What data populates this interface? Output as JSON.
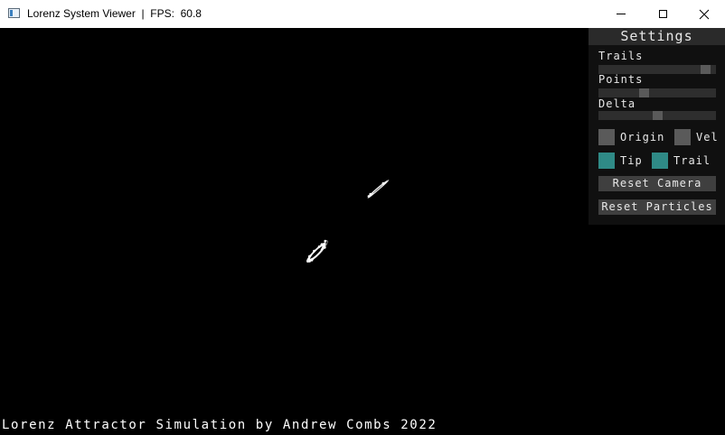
{
  "window": {
    "title": "Lorenz System Viewer  |  FPS:  60.8",
    "minimize_icon": "minimize-icon",
    "maximize_icon": "maximize-icon",
    "close_icon": "close-icon"
  },
  "settings": {
    "title": "Settings",
    "sliders": [
      {
        "label": "Trails",
        "value": 0.95
      },
      {
        "label": "Points",
        "value": 0.38
      },
      {
        "label": "Delta",
        "value": 0.5
      }
    ],
    "checkboxes": [
      {
        "label": "Origin",
        "checked": false
      },
      {
        "label": "Vel",
        "checked": false
      },
      {
        "label": "Tip",
        "checked": true
      },
      {
        "label": "Trail",
        "checked": true
      }
    ],
    "buttons": [
      {
        "label": "Reset Camera"
      },
      {
        "label": "Reset Particles"
      }
    ],
    "colors": {
      "panel_bg": "#101010",
      "header_bg": "#2a2a2a",
      "checkbox_on": "#2f8a86",
      "checkbox_off": "#5a5a5a",
      "button_bg": "#3f3f3f"
    }
  },
  "caption": "Lorenz Attractor Simulation by Andrew Combs 2022"
}
